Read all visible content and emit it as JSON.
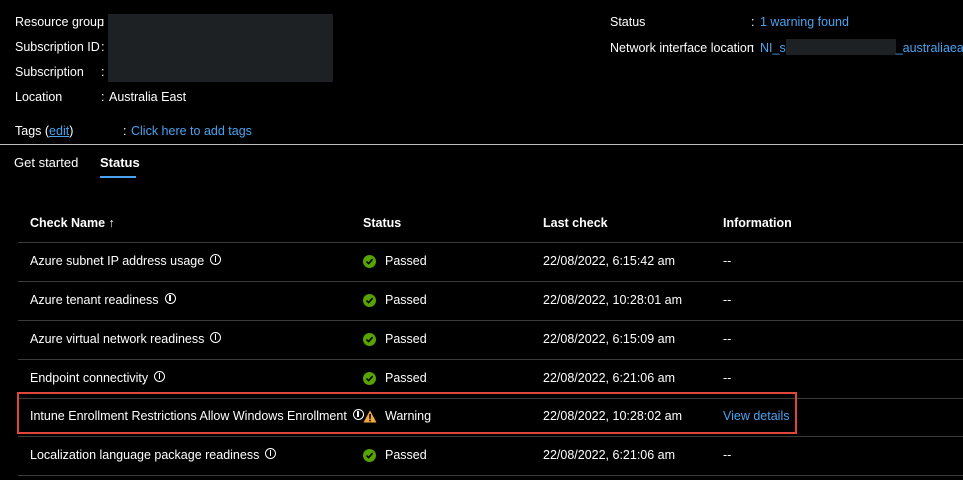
{
  "essentials": {
    "resource_group_label": "Resource group",
    "subscription_id_label": "Subscription ID",
    "subscription_label": "Subscription",
    "location_label": "Location",
    "location_value": "Australia East",
    "tags_label": "Tags (",
    "tags_edit": "edit",
    "tags_close": ")",
    "tags_value": "Click here to add tags",
    "status_label": "Status",
    "status_value": "1 warning found",
    "nic_location_label": "Network interface location",
    "nic_location_prefix": "NI_s",
    "nic_location_suffix": "_australiaeast",
    "colon": ":"
  },
  "tabs": [
    {
      "label": "Get started",
      "active": false
    },
    {
      "label": "Status",
      "active": true
    }
  ],
  "table": {
    "headers": {
      "check_name": "Check Name ↑",
      "status": "Status",
      "last_check": "Last check",
      "information": "Information"
    },
    "rows": [
      {
        "name": "Azure subnet IP address usage",
        "status": "Passed",
        "status_type": "passed",
        "last_check": "22/08/2022, 6:15:42 am",
        "info": "--"
      },
      {
        "name": "Azure tenant readiness",
        "status": "Passed",
        "status_type": "passed",
        "last_check": "22/08/2022, 10:28:01 am",
        "info": "--"
      },
      {
        "name": "Azure virtual network readiness",
        "status": "Passed",
        "status_type": "passed",
        "last_check": "22/08/2022, 6:15:09 am",
        "info": "--"
      },
      {
        "name": "Endpoint connectivity",
        "status": "Passed",
        "status_type": "passed",
        "last_check": "22/08/2022, 6:21:06 am",
        "info": "--"
      },
      {
        "name": "Intune Enrollment Restrictions Allow Windows Enrollment",
        "status": "Warning",
        "status_type": "warning",
        "last_check": "22/08/2022, 10:28:02 am",
        "info": "View details"
      },
      {
        "name": "Localization language package readiness",
        "status": "Passed",
        "status_type": "passed",
        "last_check": "22/08/2022, 6:21:06 am",
        "info": "--"
      }
    ]
  },
  "colors": {
    "accent": "#4aa3f0",
    "passed": "#57a300",
    "warning": "#f2a93b",
    "highlight": "#e0453c"
  }
}
